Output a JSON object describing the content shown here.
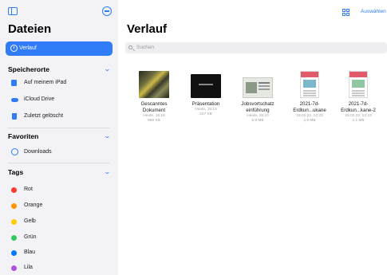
{
  "sidebar": {
    "title": "Dateien",
    "selected_item": {
      "label": "Verlauf",
      "icon": "clock-icon"
    },
    "locations": {
      "header": "Speicherorte",
      "items": [
        {
          "label": "Auf meinem iPad",
          "icon": "ipad-icon"
        },
        {
          "label": "iCloud Drive",
          "icon": "cloud-icon"
        },
        {
          "label": "Zuletzt gelöscht",
          "icon": "trash-icon"
        }
      ]
    },
    "favorites": {
      "header": "Favoriten",
      "items": [
        {
          "label": "Downloads",
          "icon": "download-icon"
        }
      ]
    },
    "tags": {
      "header": "Tags",
      "items": [
        {
          "label": "Rot",
          "color": "#ff3b30"
        },
        {
          "label": "Orange",
          "color": "#ff9500"
        },
        {
          "label": "Gelb",
          "color": "#ffcc00"
        },
        {
          "label": "Grün",
          "color": "#34c759"
        },
        {
          "label": "Blau",
          "color": "#007aff"
        },
        {
          "label": "Lila",
          "color": "#af52de"
        }
      ]
    }
  },
  "main": {
    "title": "Verlauf",
    "select_label": "Auswählen",
    "search_placeholder": "Suchen",
    "files": [
      {
        "name_line1": "Gescanntes",
        "name_line2": "Dokument",
        "date": "Heute, 15:16",
        "size": "869 KB"
      },
      {
        "name_line1": "Präsentation",
        "name_line2": "",
        "date": "Heute, 15:13",
        "size": "247 KB"
      },
      {
        "name_line1": "Jobsvortschatz",
        "name_line2": "einführung",
        "date": "Heute, 15:10",
        "size": "5,9 MB"
      },
      {
        "name_line1": "2021-7d-",
        "name_line2": "Erdkun...ukane",
        "date": "18.02.22, 12:23",
        "size": "4,9 MB"
      },
      {
        "name_line1": "2021-7d-",
        "name_line2": "Erdkun...kane-2",
        "date": "18.02.22, 12:23",
        "size": "2,1 MB"
      }
    ]
  },
  "colors": {
    "accent": "#2f7cf6",
    "sidebar_bg": "#f2f2f7"
  }
}
